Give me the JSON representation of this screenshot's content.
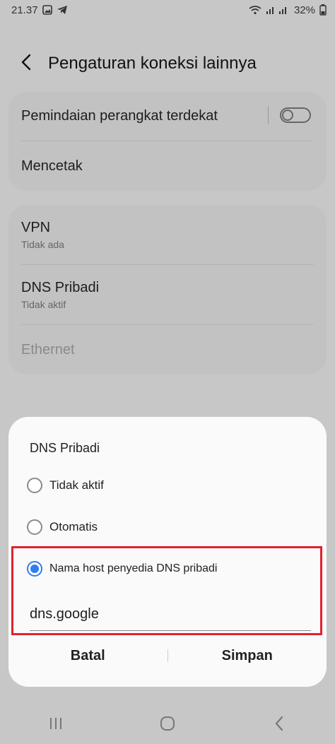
{
  "status": {
    "time": "21.37",
    "battery": "32%",
    "icons": [
      "gallery-icon",
      "telegram-icon",
      "wifi-icon",
      "signal-icon",
      "battery-icon"
    ]
  },
  "header": {
    "title": "Pengaturan koneksi lainnya"
  },
  "card1": {
    "items": [
      {
        "title": "Pemindaian perangkat terdekat",
        "toggle": "off"
      },
      {
        "title": "Mencetak"
      }
    ]
  },
  "card2": {
    "items": [
      {
        "title": "VPN",
        "subtitle": "Tidak ada"
      },
      {
        "title": "DNS Pribadi",
        "subtitle": "Tidak aktif"
      },
      {
        "title": "Ethernet"
      }
    ]
  },
  "dialog": {
    "title": "DNS Pribadi",
    "options": [
      {
        "label": "Tidak aktif",
        "checked": false
      },
      {
        "label": "Otomatis",
        "checked": false
      },
      {
        "label": "Nama host penyedia DNS pribadi",
        "checked": true
      }
    ],
    "hostname_value": "dns.google",
    "cancel_label": "Batal",
    "save_label": "Simpan"
  },
  "colors": {
    "accent": "#2f7ef0",
    "highlight": "#e0232f"
  },
  "nav": {
    "icons": [
      "recents-icon",
      "home-icon",
      "back-icon"
    ]
  }
}
